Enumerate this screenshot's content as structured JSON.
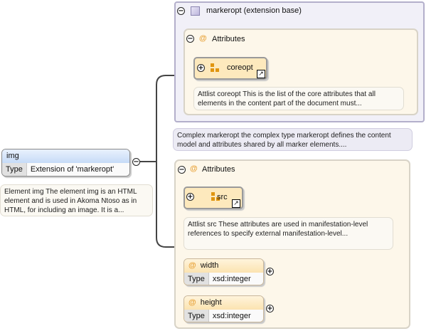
{
  "root": {
    "name": "img",
    "type_key": "Type",
    "type_value": "Extension of 'markeropt'",
    "doc": "Element img The element img is an HTML element and is used in Akoma Ntoso as in HTML, for including an image. It is a..."
  },
  "base": {
    "title": "markeropt (extension base)",
    "attributes_title": "Attributes",
    "ref_name": "coreopt",
    "ref_doc": "Attlist coreopt This is the list of the core attributes that all elements in the content part of the document must...",
    "doc": "Complex markeropt the complex type markeropt defines the content model and attributes shared by all marker elements...."
  },
  "own": {
    "attributes_title": "Attributes",
    "ref_name": "src",
    "ref_doc": "Attlist src These attributes are used in manifestation-level references to specify external manifestation-level...",
    "attrs": [
      {
        "name": "width",
        "type_key": "Type",
        "type_value": "xsd:integer"
      },
      {
        "name": "height",
        "type_key": "Type",
        "type_value": "xsd:integer"
      }
    ]
  },
  "symbols": {
    "at": "@",
    "minus": "−",
    "plus": "+",
    "link": "↗"
  },
  "colors": {
    "lavender_border": "#b3afcb",
    "cream_fill": "#fdf7ea",
    "orange_icon": "#e0950f",
    "header_blue": "#cfe0f7"
  }
}
